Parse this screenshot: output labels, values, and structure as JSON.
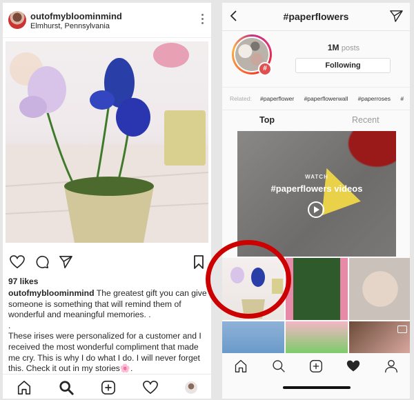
{
  "left_post": {
    "username": "outofmybloominmind",
    "location": "Elmhurst, Pennsylvania",
    "likes": "97 likes",
    "caption_user": "outofmybloominmind",
    "caption_first": " The greatest gift you can give someone is something that will remind them of wonderful and meaningful memories. .",
    "caption_dot": ".",
    "caption_second": "These irises were personalized for a customer and I received the most wonderful compliment that made me cry. This is why I do what I do. I will never forget this. Check it out in my stories🌸."
  },
  "left_nav": [
    "home-icon",
    "search-icon",
    "add-post-icon",
    "activity-heart-icon",
    "profile-avatar"
  ],
  "hashtag_page": {
    "title": "#paperflowers",
    "post_count": "1M",
    "posts_label": "posts",
    "follow_button": "Following",
    "hash_badge": "#",
    "related_label": "Related:",
    "related_tags": [
      "#paperflower",
      "#paperflowerwall",
      "#paperroses",
      "#"
    ],
    "tabs": [
      "Top",
      "Recent"
    ],
    "video_watch": "WATCH",
    "video_title": "#paperflowers videos"
  },
  "highlight_color": "#cc0000"
}
